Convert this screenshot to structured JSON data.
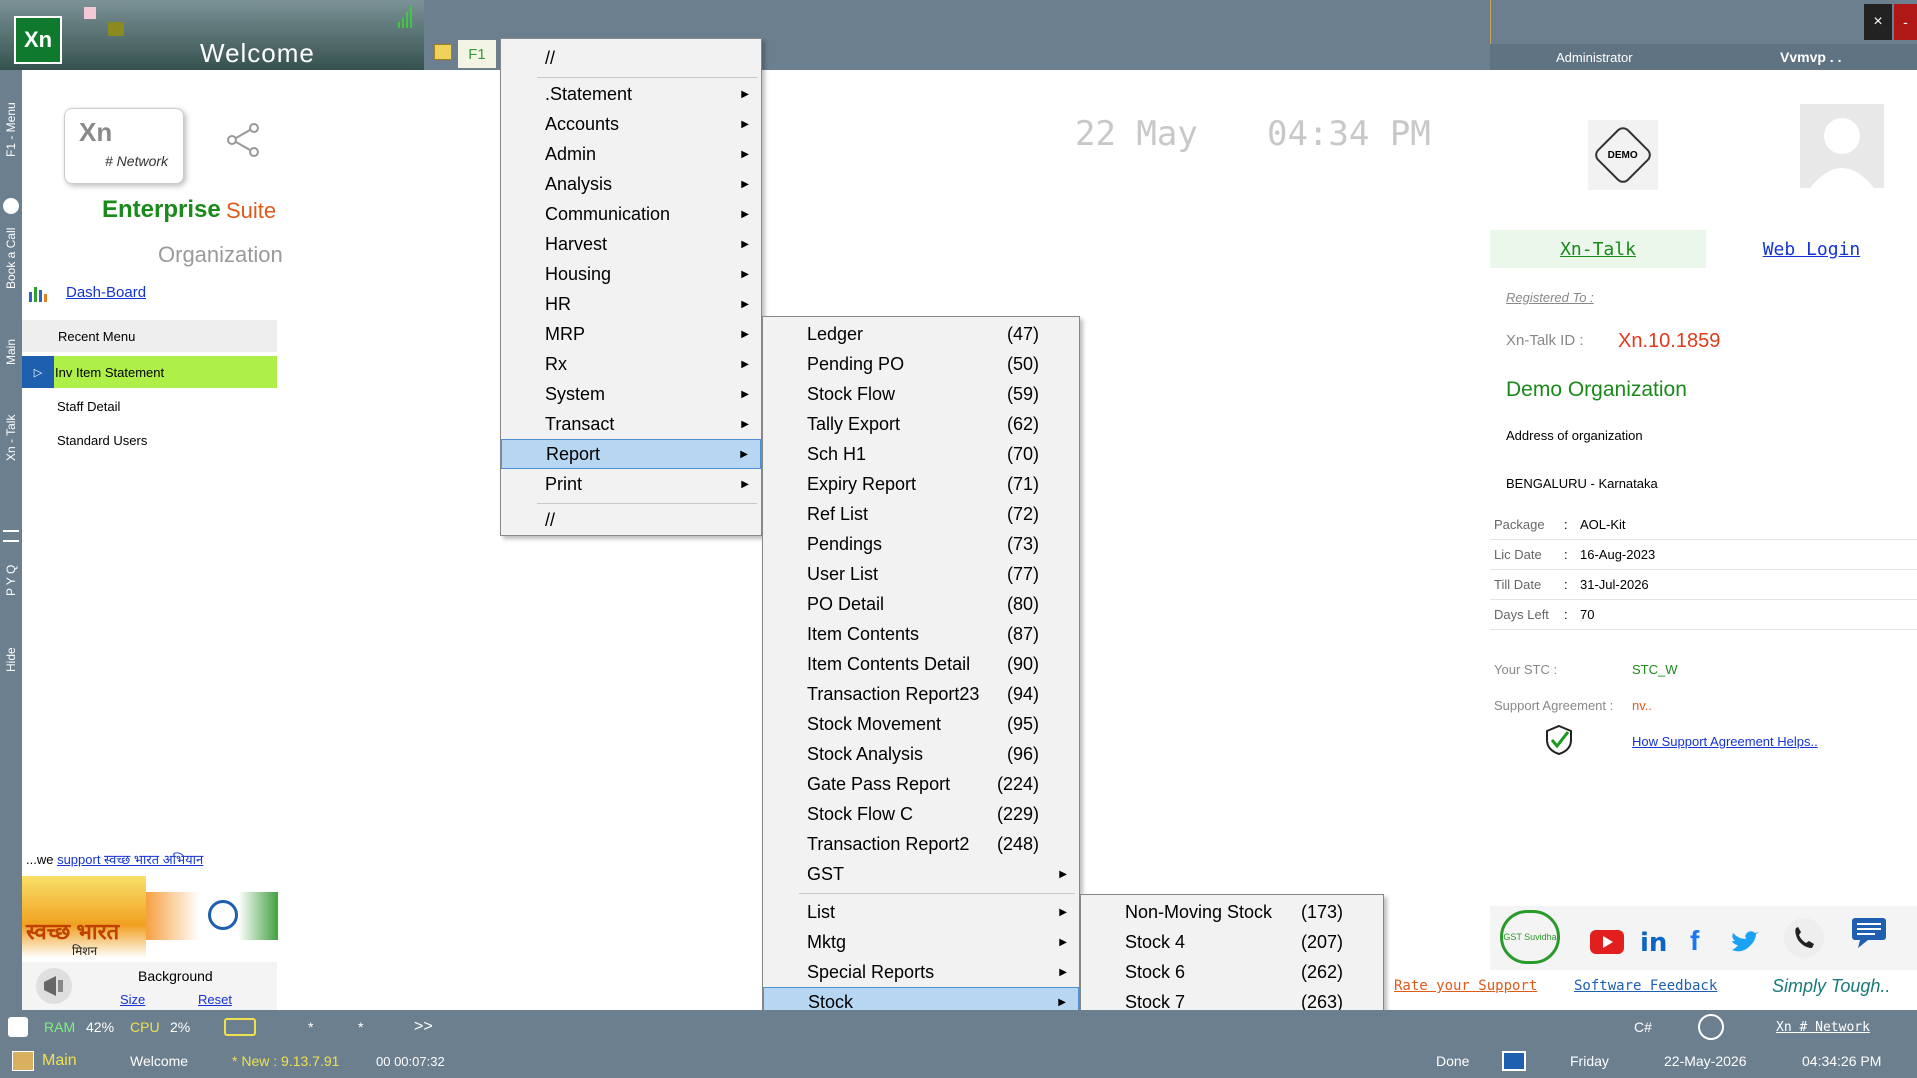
{
  "window": {
    "title": "Welcome",
    "logo_text": "Xn",
    "f1_label": "F1"
  },
  "user": {
    "role": "Administrator",
    "name": "Vvmvp . ."
  },
  "controls": {
    "close": "×",
    "minimize": "-"
  },
  "vstrip": {
    "menu": "F1 - Menu",
    "book_call": "Book a Call",
    "main": "Main",
    "xn_talk": "Xn - Talk",
    "pyq": "P Y Q",
    "hide": "Hide"
  },
  "brand": {
    "xn": "Xn",
    "network": "# Network",
    "enterprise": "Enterprise",
    "suite": "Suite",
    "organization": "Organization"
  },
  "dashboard": {
    "label": "Dash-Board"
  },
  "recent": {
    "heading": "Recent Menu",
    "items": [
      "Inv Item Statement",
      "Staff Detail",
      "Standard Users"
    ]
  },
  "swachh": {
    "prefix": "...we ",
    "link": "support स्वच्छ भारत अभियान",
    "logo_text": "स्वच्छ भारत",
    "logo_sub": "मिशन"
  },
  "background": {
    "title": "Background",
    "size": "Size",
    "reset": "Reset"
  },
  "clock": {
    "date": "22 May",
    "time": "04:34 PM"
  },
  "main_menu": {
    "top": "//",
    "items": [
      ".Statement",
      "Accounts",
      "Admin",
      "Analysis",
      "Communication",
      "Harvest",
      "Housing",
      "HR",
      "MRP",
      "Rx",
      "System",
      "Transact",
      "Report",
      "Print"
    ],
    "selected": "Report",
    "bottom": "//"
  },
  "report_menu": {
    "items": [
      {
        "label": "Ledger",
        "code": "(47)"
      },
      {
        "label": "Pending PO",
        "code": "(50)"
      },
      {
        "label": "Stock Flow",
        "code": "(59)"
      },
      {
        "label": "Tally Export",
        "code": "(62)"
      },
      {
        "label": "Sch H1",
        "code": "(70)"
      },
      {
        "label": "Expiry Report",
        "code": "(71)"
      },
      {
        "label": "Ref List",
        "code": "(72)"
      },
      {
        "label": "Pendings",
        "code": "(73)"
      },
      {
        "label": "User List",
        "code": "(77)"
      },
      {
        "label": "PO Detail",
        "code": "(80)"
      },
      {
        "label": "Item Contents",
        "code": "(87)"
      },
      {
        "label": "Item Contents Detail",
        "code": "(90)"
      },
      {
        "label": "Transaction Report23",
        "code": "(94)"
      },
      {
        "label": "Stock Movement",
        "code": "(95)"
      },
      {
        "label": "Stock Analysis",
        "code": "(96)"
      },
      {
        "label": "Gate Pass Report",
        "code": "(224)"
      },
      {
        "label": "Stock Flow C",
        "code": "(229)"
      },
      {
        "label": "Transaction Report2",
        "code": "(248)"
      }
    ],
    "submenus": [
      "GST",
      "List",
      "Mktg",
      "Special Reports",
      "Stock"
    ],
    "selected": "Stock"
  },
  "stock_menu": {
    "items": [
      {
        "label": "Non-Moving Stock",
        "code": "(173)"
      },
      {
        "label": "Stock 4",
        "code": "(207)"
      },
      {
        "label": "Stock 6",
        "code": "(262)"
      },
      {
        "label": "Stock 7",
        "code": "(263)"
      }
    ]
  },
  "right": {
    "demo_badge": "DEMO",
    "xn_talk": "Xn-Talk",
    "web_login": "Web Login",
    "registered_to": "Registered To :",
    "xn_talk_id_label": "Xn-Talk ID :",
    "xn_talk_id": "Xn.10.1859",
    "org_name": "Demo Organization",
    "address": "Address of organization",
    "city": "BENGALURU - Karnataka",
    "rows": [
      {
        "label": "Package",
        "sep": ":",
        "value": "AOL-Kit"
      },
      {
        "label": "Lic Date",
        "sep": ":",
        "value": "16-Aug-2023"
      },
      {
        "label": "Till Date",
        "sep": ":",
        "value": "31-Jul-2026"
      },
      {
        "label": "Days Left",
        "sep": ":",
        "value": "70"
      }
    ],
    "stc_label": "Your STC :",
    "stc_value": "STC_W",
    "support_label": "Support Agreement :",
    "support_value": "nv..",
    "support_link": "How Support Agreement Helps..",
    "rate_support": "Rate your Support",
    "software_feedback": "Software Feedback",
    "simply_tough": "Simply Tough..",
    "gst_badge": "GST Suvidha"
  },
  "status_bar1": {
    "ram_label": "RAM",
    "ram": "42%",
    "cpu_label": "CPU",
    "cpu": "2%",
    "star1": "*",
    "star2": "*",
    "more": ">>",
    "lang": "C#",
    "network": "Xn # Network"
  },
  "status_bar2": {
    "main": "Main",
    "welcome": "Welcome",
    "version": "* New : 9.13.7.91",
    "elapsed": "00 00:07:32",
    "done": "Done",
    "day": "Friday",
    "date": "22-May-2026",
    "time": "04:34:26 PM"
  }
}
